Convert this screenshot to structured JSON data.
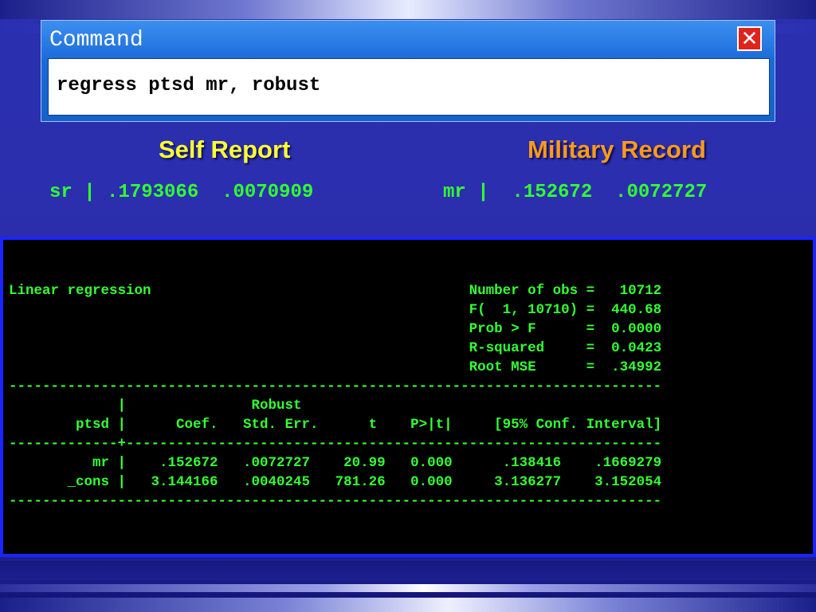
{
  "command_window": {
    "title": "Command",
    "input_value": "regress ptsd mr, robust"
  },
  "headings": {
    "self_report": "Self Report",
    "military_record": "Military Record"
  },
  "coefficients": {
    "self_report_line": "sr | .1793066  .0070909",
    "military_record_line": "mr |  .152672  .0072727"
  },
  "colors": {
    "self_report_heading": "#ffff33",
    "military_record_heading": "#ff9a1a",
    "terminal_text": "#33ff33",
    "close_button": "#e0241c"
  },
  "output": {
    "lines": [
      "Linear regression                                      Number of obs =   10712",
      "                                                       F(  1, 10710) =  440.68",
      "                                                       Prob > F      =  0.0000",
      "                                                       R-squared     =  0.0423",
      "                                                       Root MSE      =  .34992",
      "------------------------------------------------------------------------------",
      "             |               Robust",
      "        ptsd |      Coef.   Std. Err.      t    P>|t|     [95% Conf. Interval]",
      "-------------+----------------------------------------------------------------",
      "          mr |    .152672   .0072727    20.99   0.000      .138416    .1669279",
      "       _cons |   3.144166   .0040245   781.26   0.000     3.136277    3.152054",
      "------------------------------------------------------------------------------"
    ]
  }
}
